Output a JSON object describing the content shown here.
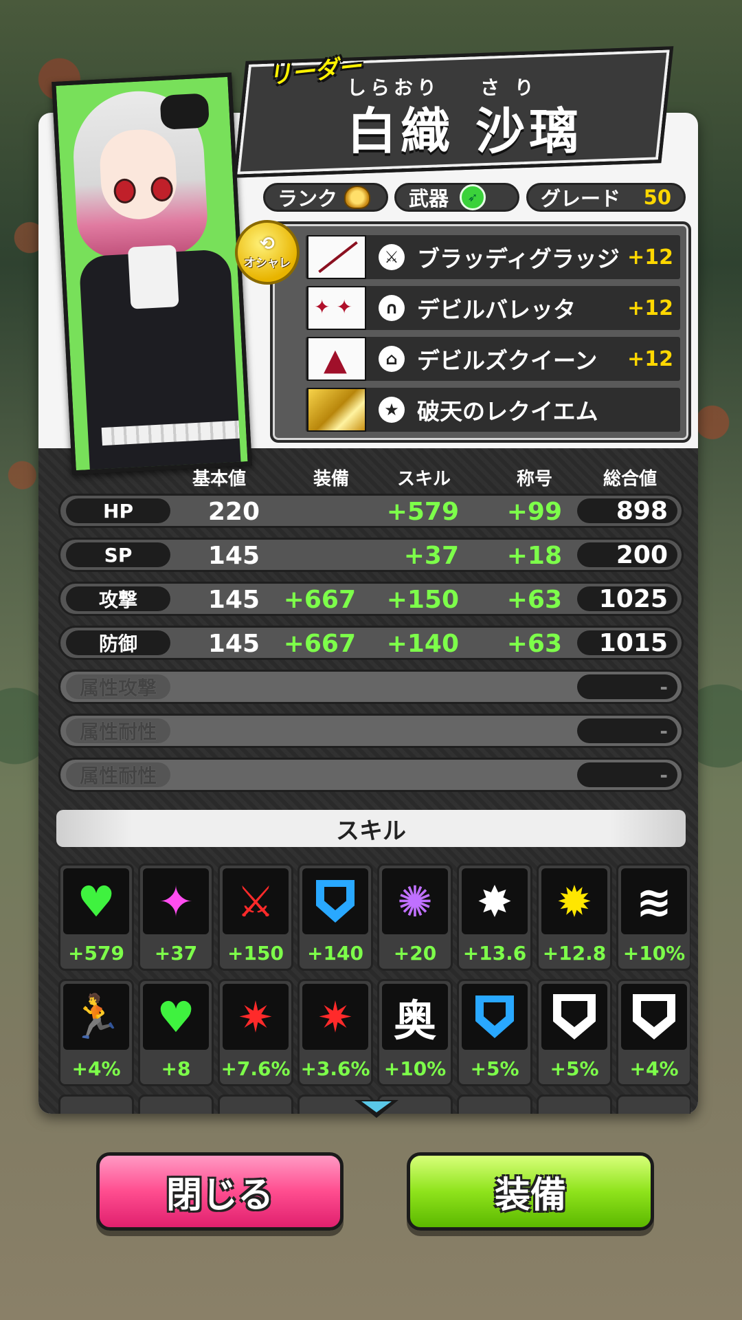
{
  "leader_label": "リーダー",
  "character": {
    "ruby_family": "しらおり",
    "ruby_given": "さ り",
    "name": "白織 沙璃"
  },
  "info_pills": {
    "rank_label": "ランク",
    "weapon_label": "武器",
    "grade_label": "グレード",
    "grade_value": "50"
  },
  "fashion_badge": "オシャレ",
  "equipment": [
    {
      "name": "ブラッディグラッジ",
      "level": "+12",
      "icon": "sword-icon"
    },
    {
      "name": "デビルバレッタ",
      "level": "+12",
      "icon": "headgear-icon"
    },
    {
      "name": "デビルズクイーン",
      "level": "+12",
      "icon": "dress-icon"
    },
    {
      "name": "破天のレクイエム",
      "level": "",
      "icon": "star-icon"
    }
  ],
  "stat_headers": {
    "base": "基本値",
    "equip": "装備",
    "skill": "スキル",
    "title": "称号",
    "total": "総合値"
  },
  "stats": [
    {
      "label": "HP",
      "base": "220",
      "equip": "",
      "skill": "+579",
      "title": "+99",
      "total": "898"
    },
    {
      "label": "SP",
      "base": "145",
      "equip": "",
      "skill": "+37",
      "title": "+18",
      "total": "200"
    },
    {
      "label": "攻撃",
      "base": "145",
      "equip": "+667",
      "skill": "+150",
      "title": "+63",
      "total": "1025"
    },
    {
      "label": "防御",
      "base": "145",
      "equip": "+667",
      "skill": "+140",
      "title": "+63",
      "total": "1015"
    },
    {
      "label": "属性攻撃",
      "base": "",
      "equip": "",
      "skill": "",
      "title": "",
      "total": "-"
    },
    {
      "label": "属性耐性",
      "base": "",
      "equip": "",
      "skill": "",
      "title": "",
      "total": "-"
    },
    {
      "label": "属性耐性",
      "base": "",
      "equip": "",
      "skill": "",
      "title": "",
      "total": "-"
    }
  ],
  "skill_section_title": "スキル",
  "skills_row1": [
    {
      "value": "+579",
      "icon": "heart-icon"
    },
    {
      "value": "+37",
      "icon": "sparkle-icon"
    },
    {
      "value": "+150",
      "icon": "sword-icon"
    },
    {
      "value": "+140",
      "icon": "shield-icon"
    },
    {
      "value": "+20",
      "icon": "swirl-icon"
    },
    {
      "value": "+13.6",
      "icon": "knockback-icon"
    },
    {
      "value": "+12.8",
      "icon": "stun-icon"
    },
    {
      "value": "+10%",
      "icon": "dash-icon"
    }
  ],
  "skills_row2": [
    {
      "value": "+4%",
      "icon": "run-icon"
    },
    {
      "value": "+8",
      "icon": "heart-sparkle-icon"
    },
    {
      "value": "+7.6%",
      "icon": "critical-sword-icon"
    },
    {
      "value": "+3.6%",
      "icon": "critical-sword-icon"
    },
    {
      "value": "+10%",
      "icon": "kanji-oku-icon",
      "glyph": "奥"
    },
    {
      "value": "+5%",
      "icon": "shield-percent-icon"
    },
    {
      "value": "+5%",
      "icon": "shield-white-icon"
    },
    {
      "value": "+4%",
      "icon": "shield-white-icon"
    }
  ],
  "buttons": {
    "close": "閉じる",
    "equip": "装備"
  },
  "colors": {
    "bonus_green": "#7dff4a",
    "level_gold": "#ffd700",
    "close_pink": "#ff4d8f",
    "equip_green": "#8fe31c"
  }
}
